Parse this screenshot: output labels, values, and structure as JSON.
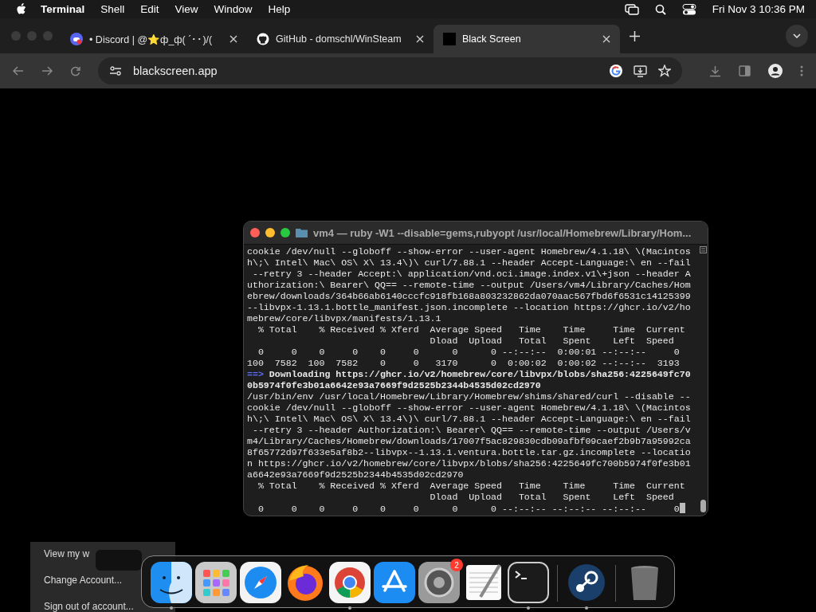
{
  "menu_bar": {
    "app_name": "Terminal",
    "items": [
      "Shell",
      "Edit",
      "View",
      "Window",
      "Help"
    ],
    "clock": "Fri Nov 3  10:36 PM"
  },
  "browser": {
    "tabs": [
      {
        "title": "• Discord | @⭐ф_ф( ´･･)/(",
        "selected": false
      },
      {
        "title": "GitHub - domschl/WinSteam",
        "selected": false
      },
      {
        "title": "Black Screen",
        "selected": true
      }
    ],
    "address": "blackscreen.app"
  },
  "terminal": {
    "title": "vm4 — ruby -W1 --disable=gems,rubyopt /usr/local/Homebrew/Library/Hom...",
    "lines": [
      {
        "kind": "plain",
        "text": "cookie /dev/null --globoff --show-error --user-agent Homebrew/4.1.18\\ \\(Macintos"
      },
      {
        "kind": "plain",
        "text": "h\\;\\ Intel\\ Mac\\ OS\\ X\\ 13.4\\)\\ curl/7.88.1 --header Accept-Language:\\ en --fail"
      },
      {
        "kind": "plain",
        "text": " --retry 3 --header Accept:\\ application/vnd.oci.image.index.v1\\+json --header A"
      },
      {
        "kind": "plain",
        "text": "uthorization:\\ Bearer\\ QQ== --remote-time --output /Users/vm4/Library/Caches/Hom"
      },
      {
        "kind": "plain",
        "text": "ebrew/downloads/364b66ab6140cccfc918fb168a803232862da070aac567fbd6f6531c14125399"
      },
      {
        "kind": "plain",
        "text": "--libvpx-1.13.1.bottle_manifest.json.incomplete --location https://ghcr.io/v2/ho"
      },
      {
        "kind": "plain",
        "text": "mebrew/core/libvpx/manifests/1.13.1"
      },
      {
        "kind": "plain",
        "text": "  % Total    % Received % Xferd  Average Speed   Time    Time     Time  Current"
      },
      {
        "kind": "plain",
        "text": "                                 Dload  Upload   Total   Spent    Left  Speed"
      },
      {
        "kind": "plain",
        "text": "  0     0    0     0    0     0      0      0 --:--:--  0:00:01 --:--:--     0"
      },
      {
        "kind": "plain",
        "text": "100  7582  100  7582    0     0   3170      0  0:00:02  0:00:02 --:--:--  3193"
      },
      {
        "kind": "arrow",
        "prefix": "==>",
        "text": "Downloading https://ghcr.io/v2/homebrew/core/libvpx/blobs/sha256:4225649fc70"
      },
      {
        "kind": "bold",
        "text": "0b5974f0fe3b01a6642e93a7669f9d2525b2344b4535d02cd2970"
      },
      {
        "kind": "plain",
        "text": "/usr/bin/env /usr/local/Homebrew/Library/Homebrew/shims/shared/curl --disable --"
      },
      {
        "kind": "plain",
        "text": "cookie /dev/null --globoff --show-error --user-agent Homebrew/4.1.18\\ \\(Macintos"
      },
      {
        "kind": "plain",
        "text": "h\\;\\ Intel\\ Mac\\ OS\\ X\\ 13.4\\)\\ curl/7.88.1 --header Accept-Language:\\ en --fail"
      },
      {
        "kind": "plain",
        "text": " --retry 3 --header Authorization:\\ Bearer\\ QQ== --remote-time --output /Users/v"
      },
      {
        "kind": "plain",
        "text": "m4/Library/Caches/Homebrew/downloads/17007f5ac829830cdb09afbf09caef2b9b7a95992ca"
      },
      {
        "kind": "plain",
        "text": "8f65772d97f633e5af8b2--libvpx--1.13.1.ventura.bottle.tar.gz.incomplete --locatio"
      },
      {
        "kind": "plain",
        "text": "n https://ghcr.io/v2/homebrew/core/libvpx/blobs/sha256:4225649fc700b5974f0fe3b01"
      },
      {
        "kind": "plain",
        "text": "a6642e93a7669f9d2525b2344b4535d02cd2970"
      },
      {
        "kind": "plain",
        "text": "  % Total    % Received % Xferd  Average Speed   Time    Time     Time  Current"
      },
      {
        "kind": "plain",
        "text": "                                 Dload  Upload   Total   Spent    Left  Speed"
      },
      {
        "kind": "plain",
        "text": "  0     0    0     0    0     0      0      0 --:--:-- --:--:-- --:--:--     0"
      }
    ]
  },
  "background_menu": {
    "items": [
      "View my w",
      "Change Account...",
      "Sign out of account..."
    ]
  },
  "dock": {
    "items": [
      {
        "kind": "app",
        "running": true
      },
      {
        "kind": "app",
        "running": false
      },
      {
        "kind": "app",
        "running": false
      },
      {
        "kind": "app",
        "running": false
      },
      {
        "kind": "app",
        "running": true
      },
      {
        "kind": "app",
        "running": false
      },
      {
        "kind": "app",
        "running": false,
        "badge": "2"
      },
      {
        "kind": "app",
        "running": false
      },
      {
        "kind": "app",
        "running": true
      },
      {
        "kind": "divider"
      },
      {
        "kind": "app",
        "running": true
      },
      {
        "kind": "divider"
      },
      {
        "kind": "app",
        "running": false
      }
    ]
  }
}
